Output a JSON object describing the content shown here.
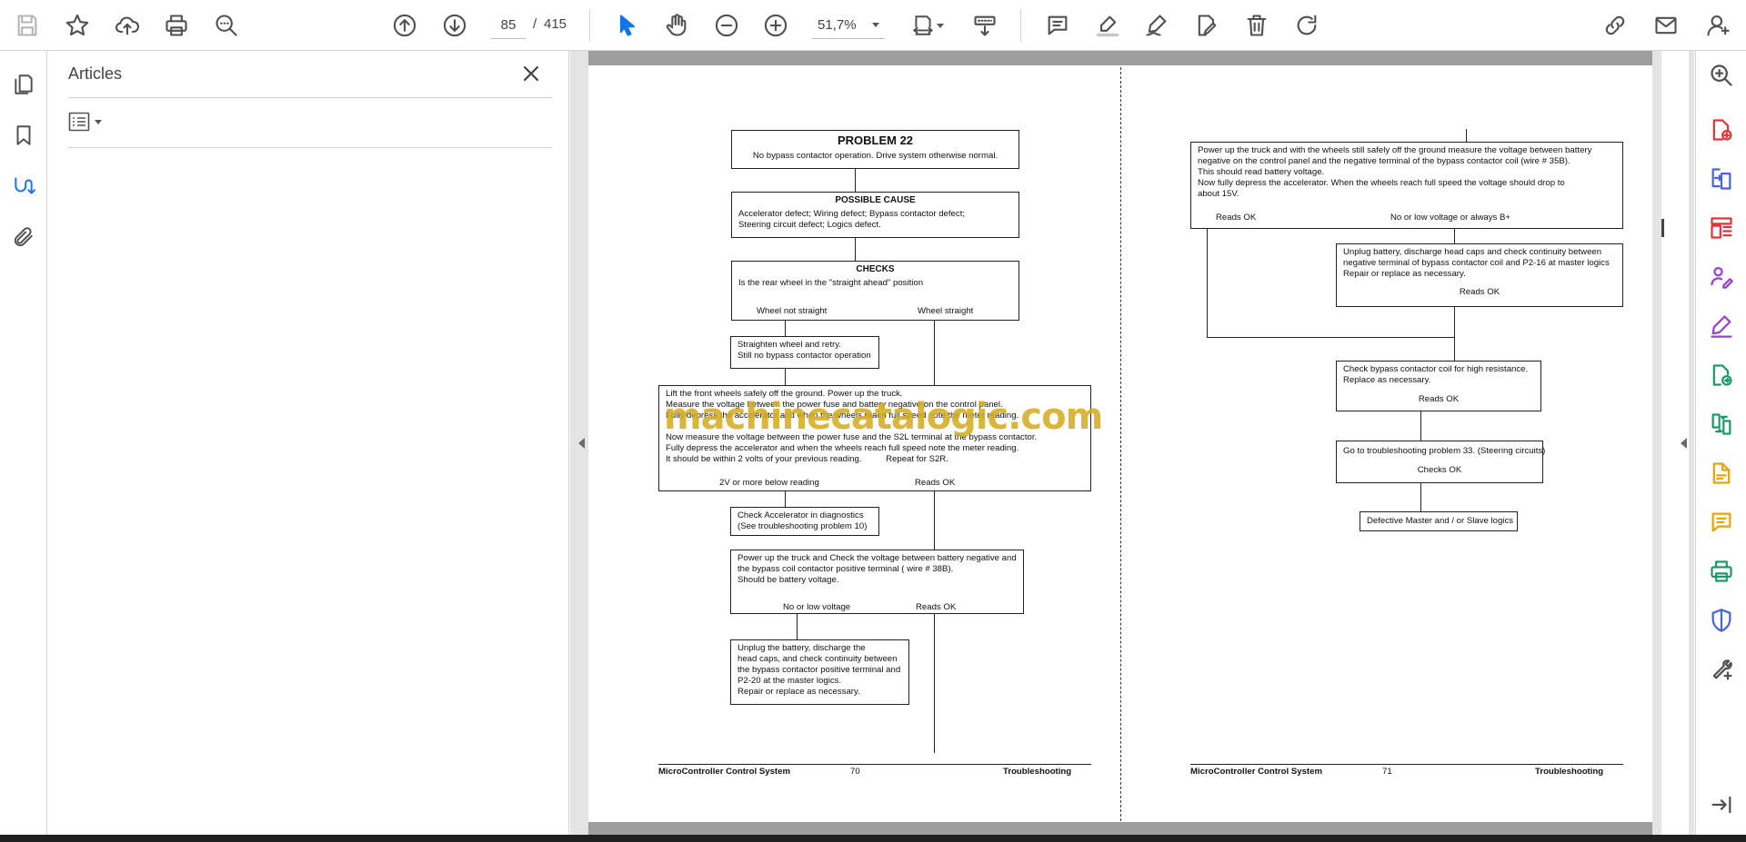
{
  "toolbar": {
    "page_current": "85",
    "page_separator": "/",
    "page_total": "415",
    "zoom": "51,7%"
  },
  "articles_panel": {
    "title": "Articles"
  },
  "watermark": "machinecatalogic.com",
  "left_page": {
    "problem_box": {
      "title": "PROBLEM 22",
      "text": "No bypass contactor operation. Drive system otherwise normal."
    },
    "cause_box": {
      "title": "POSSIBLE CAUSE",
      "lines": [
        "Accelerator defect; Wiring defect; Bypass contactor defect;",
        "Steering circuit defect; Logics defect."
      ]
    },
    "checks_box": {
      "title": "CHECKS",
      "text": "Is the rear wheel in the \"straight ahead\" position",
      "left_label": "Wheel not straight",
      "right_label": "Wheel straight"
    },
    "straighten_box": {
      "lines": [
        "Straighten wheel and retry.",
        "Still no bypass contactor operation"
      ]
    },
    "lift_box": {
      "lines": [
        "Lift the front wheels safely off the ground. Power up the truck.",
        "Measure the voltage between the power fuse and battery negative on the control panel.",
        "Fully depress the accelerator and when the wheels reach full speed note the meter reading.",
        "",
        "Now measure the voltage between the power fuse and the S2L terminal at the bypass contactor.",
        "Fully depress the accelerator and when the wheels reach full speed note the meter reading.",
        "It should be within 2 volts of your previous reading.          Repeat for S2R."
      ],
      "left_label": "2V or more below reading",
      "right_label": "Reads OK"
    },
    "accel_box": {
      "lines": [
        "Check Accelerator in diagnostics",
        "(See troubleshooting problem 10)"
      ]
    },
    "power_box": {
      "lines": [
        "Power up the truck and Check the voltage between battery negative and",
        "the bypass coil contactor positive terminal ( wire # 38B).",
        "Should be battery voltage."
      ],
      "left_label": "No or low voltage",
      "right_label": "Reads OK"
    },
    "unplug_box": {
      "lines": [
        "Unplug the battery, discharge the",
        "head caps, and check continuity between",
        "the bypass contactor positive terminal and",
        "P2-20 at the master logics.",
        "Repair or replace as necessary."
      ]
    },
    "footer": {
      "left": "MicroController Control System",
      "center": "70",
      "right": "Troubleshooting"
    }
  },
  "right_page": {
    "power_box": {
      "lines": [
        "Power up the truck and with the wheels still safely off the ground measure the voltage between battery",
        "negative on the control panel and the negative terminal of the bypass contactor coil (wire # 35B).",
        "This should read battery voltage.",
        "Now fully depress the accelerator. When the wheels reach full speed the voltage should drop to",
        "about 15V."
      ],
      "left_label": "Reads OK",
      "right_label": "No or low voltage or always B+"
    },
    "unplug_box": {
      "lines": [
        "Unplug battery, discharge head caps and check continuity between",
        "negative terminal of bypass contactor coil and P2-16 at master logics",
        "Repair or replace as necessary."
      ],
      "label": "Reads OK"
    },
    "coil_box": {
      "lines": [
        "Check bypass contactor coil for high resistance.",
        "Replace as necessary."
      ],
      "label": "Reads OK"
    },
    "goto_box": {
      "line": "Go to troubleshooting problem 33. (Steering circuits)",
      "label": "Checks OK"
    },
    "defective_box": {
      "line": "Defective Master and / or Slave logics"
    },
    "footer": {
      "left": "MicroController Control System",
      "center": "71",
      "right": "Troubleshooting"
    }
  }
}
